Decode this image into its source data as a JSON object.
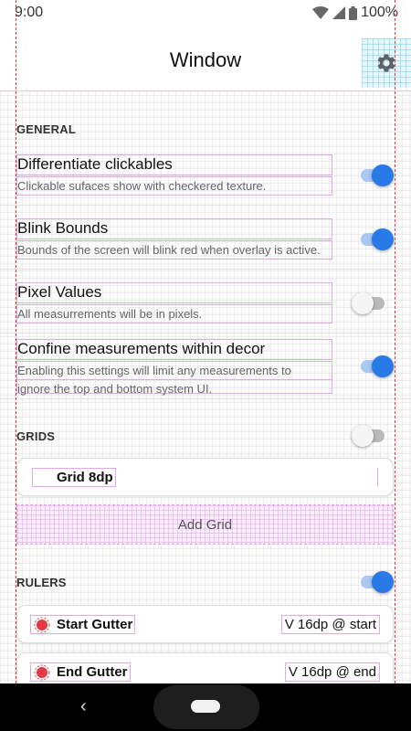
{
  "status_bar": {
    "time": "9:00",
    "battery": "100%"
  },
  "app_bar": {
    "title": "Window",
    "settings_icon": "gear-icon"
  },
  "general": {
    "header": "GENERAL",
    "items": [
      {
        "title": "Differentiate clickables",
        "summary": "Clickable sufaces show with checkered texture.",
        "enabled": true
      },
      {
        "title": "Blink Bounds",
        "summary": "Bounds of the screen will blink red when overlay is active.",
        "enabled": true
      },
      {
        "title": "Pixel Values",
        "summary": "All measurrements will be in pixels.",
        "enabled": false
      },
      {
        "title": "Confine measurements within decor",
        "summary_line1": "Enabling this settings will limit any measurements to",
        "summary_line2": "ignore the top and bottom system UI.",
        "enabled": true
      }
    ]
  },
  "grids": {
    "header": "GRIDS",
    "enabled": false,
    "items": [
      {
        "label": "Grid 8dp"
      }
    ],
    "add_label": "Add Grid"
  },
  "rulers": {
    "header": "RULERS",
    "enabled": true,
    "items": [
      {
        "label": "Start Gutter",
        "value": "V 16dp @ start",
        "color": "#e53945"
      },
      {
        "label": "End Gutter",
        "value": "V 16dp @ end",
        "color": "#e53945"
      }
    ]
  },
  "colors": {
    "accent": "#2979e8",
    "switch_track_on": "#a9c8f3",
    "bounds_outline": "#e2a6ea",
    "gutter_line": "#e53935"
  },
  "nav_bar": {
    "back_icon": "back-chevron-icon",
    "home_icon": "home-pill-icon"
  }
}
